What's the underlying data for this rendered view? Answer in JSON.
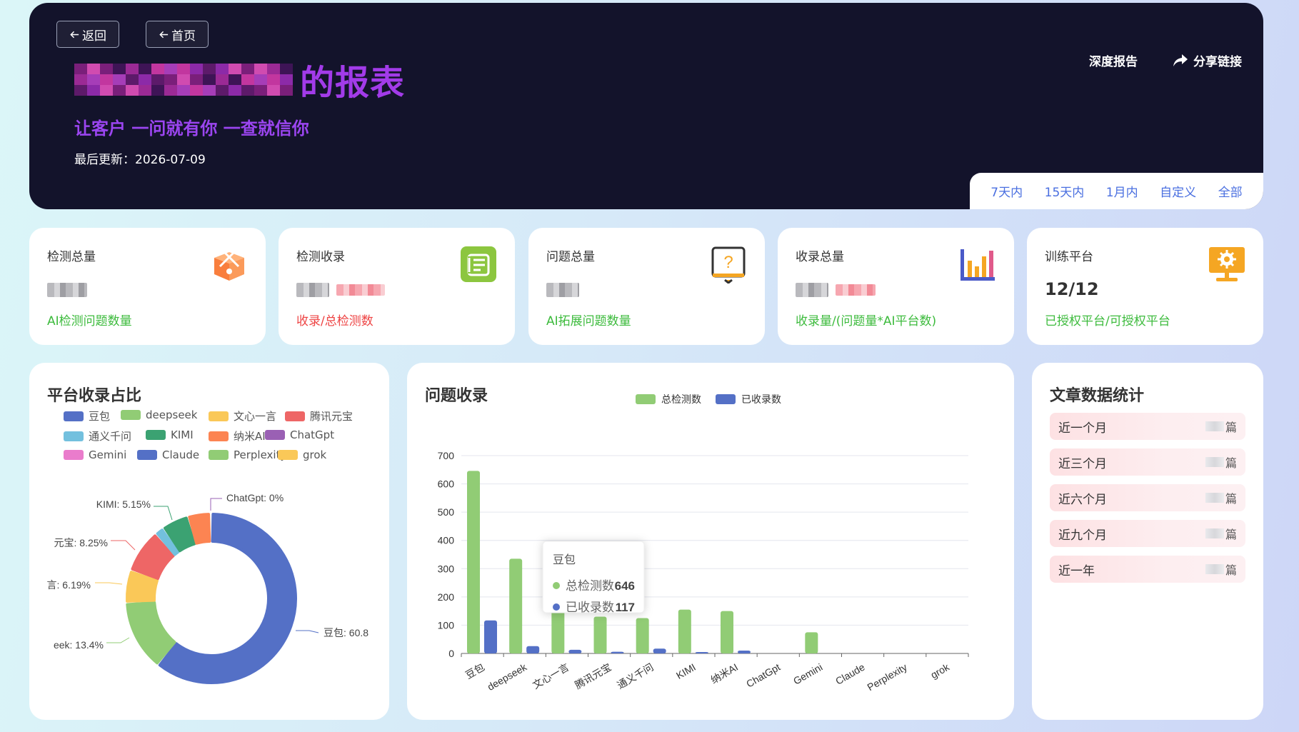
{
  "header": {
    "back_label": "返回",
    "home_label": "首页",
    "title": "的报表",
    "slogan": "让客户 一问就有你 一查就信你",
    "updated": "最后更新：2026-07-09",
    "deep_report": "深度报告",
    "share_link": "分享链接",
    "filters": [
      "7天内",
      "15天内",
      "1月内",
      "自定义",
      "全部"
    ]
  },
  "stats": [
    {
      "label": "检测总量",
      "value": "",
      "sub": "AI检测问题数量",
      "sub_color": "#3dbb3d",
      "icon": "box-icon"
    },
    {
      "label": "检测收录",
      "value": "",
      "sub": "收录/总检测数",
      "sub_color": "#ee4444",
      "icon": "list-icon"
    },
    {
      "label": "问题总量",
      "value": "",
      "sub": "AI拓展问题数量",
      "sub_color": "#3dbb3d",
      "icon": "question-board-icon"
    },
    {
      "label": "收录总量",
      "value": "",
      "sub": "收录量/(问题量*AI平台数)",
      "sub_color": "#3dbb3d",
      "icon": "bar-chart-icon"
    },
    {
      "label": "训练平台",
      "value": "12/12",
      "sub": "已授权平台/可授权平台",
      "sub_color": "#3dbb3d",
      "icon": "monitor-gear-icon"
    }
  ],
  "pie_panel": {
    "title": "平台收录占比",
    "legend": [
      {
        "name": "豆包",
        "color": "#5470c6"
      },
      {
        "name": "deepseek",
        "color": "#91cc75"
      },
      {
        "name": "文心一言",
        "color": "#fac858"
      },
      {
        "name": "腾讯元宝",
        "color": "#ee6666"
      },
      {
        "name": "通义千问",
        "color": "#73c0de"
      },
      {
        "name": "KIMI",
        "color": "#3ba272"
      },
      {
        "name": "纳米AI",
        "color": "#fc8452"
      },
      {
        "name": "ChatGpt",
        "color": "#9a60b4"
      },
      {
        "name": "Gemini",
        "color": "#ea7ccc"
      },
      {
        "name": "Claude",
        "color": "#5470c6"
      },
      {
        "name": "Perplexity",
        "color": "#91cc75"
      },
      {
        "name": "grok",
        "color": "#fac858"
      }
    ],
    "labels": {
      "doubao": "豆包: 60.8",
      "deepseek": "eek: 13.4%",
      "wenxin": "言: 6.19%",
      "yuanbao": "元宝: 8.25%",
      "kimi": "KIMI: 5.15%",
      "chatgpt": "ChatGpt: 0%"
    }
  },
  "chart_data": {
    "type": "bar",
    "title": "问题收录",
    "categories": [
      "豆包",
      "deepseek",
      "文心一言",
      "腾讯元宝",
      "通义千问",
      "KIMI",
      "纳米AI",
      "ChatGpt",
      "Gemini",
      "Claude",
      "Perplexity",
      "grok"
    ],
    "series": [
      {
        "name": "总检测数",
        "color": "#91cc75",
        "values": [
          646,
          335,
          150,
          130,
          125,
          155,
          150,
          0,
          75,
          0,
          0,
          0
        ]
      },
      {
        "name": "已收录数",
        "color": "#5470c6",
        "values": [
          117,
          26,
          13,
          6,
          17,
          5,
          10,
          0,
          0,
          0,
          0,
          0
        ]
      }
    ],
    "ylim": [
      0,
      700
    ],
    "yticks": [
      0,
      100,
      200,
      300,
      400,
      500,
      600,
      700
    ],
    "grid": true,
    "legend_position": "top-center",
    "tooltip": {
      "category": "豆包",
      "rows": [
        {
          "name": "总检测数",
          "value": "646",
          "color": "#91cc75"
        },
        {
          "name": "已收录数",
          "value": "117",
          "color": "#5470c6"
        }
      ]
    }
  },
  "articles": {
    "title": "文章数据统计",
    "unit": "篇",
    "rows": [
      "近一个月",
      "近三个月",
      "近六个月",
      "近九个月",
      "近一年"
    ]
  }
}
